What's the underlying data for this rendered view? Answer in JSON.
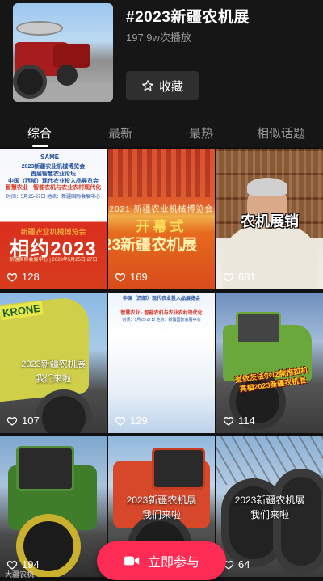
{
  "header": {
    "title": "#2023新疆农机展",
    "plays": "197.9w次播放",
    "favorite_label": "收藏"
  },
  "tabs": [
    {
      "label": "综合",
      "active": true
    },
    {
      "label": "最新",
      "active": false
    },
    {
      "label": "最热",
      "active": false
    },
    {
      "label": "相似话题",
      "active": false
    }
  ],
  "videos": [
    {
      "likes": "128",
      "texts": {
        "logo": "SAME",
        "line1": "2023新疆农业机械博览会",
        "line1b": "首届智慧农业论坛",
        "line1c": "中国（西部）现代农业投入品展览会",
        "line2": "智慧农业 · 智能农机与农业农村现代化",
        "line3": "时间：5月25-27日 地点：新疆国际会展中心",
        "sub": "新疆农业机械博览会",
        "big": "相约2023",
        "foot": "新疆国际会展中心 | 2023年5月25日-27日"
      }
    },
    {
      "likes": "169",
      "texts": {
        "top": "2021 新疆农业机械博览会",
        "mid": "开幕式",
        "big": "23新疆农机展"
      }
    },
    {
      "likes": "681",
      "texts": {
        "caption": "农机展销"
      }
    },
    {
      "likes": "107",
      "texts": {
        "brand": "KRONE",
        "line1": "2023新疆农机展",
        "line2": "我们来啦"
      }
    },
    {
      "likes": "129",
      "texts": {
        "line1": "中国（西部）现代农业投入品展览会",
        "line2": "智慧农业 · 智能农机与农业农村现代化",
        "line3": "时间：5月25-27日 地点：新疆国际会展中心"
      }
    },
    {
      "likes": "114",
      "texts": {
        "line1": "道依茨法尔12款拖拉机",
        "line2": "亮相2023新疆农机展"
      }
    },
    {
      "likes": "194",
      "texts": {}
    },
    {
      "likes": "",
      "texts": {
        "line1": "2023新疆农机展",
        "line2": "我们来啦"
      }
    },
    {
      "likes": "64",
      "texts": {
        "line1": "2023新疆农机展",
        "line2": "我们来啦"
      }
    }
  ],
  "watermark": "大疆农机",
  "cta_label": "立即参与",
  "colors": {
    "accent": "#fe2c55",
    "background": "#111111"
  }
}
